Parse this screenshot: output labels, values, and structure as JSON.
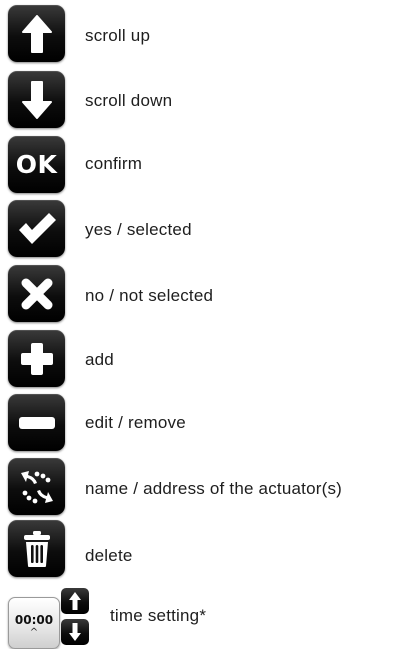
{
  "legend": {
    "scroll_up": "scroll up",
    "scroll_down": "scroll down",
    "confirm_symbol": "OK",
    "confirm": "confirm",
    "yes_selected": "yes / selected",
    "no_not_selected": "no / not selected",
    "add": "add",
    "edit_remove": "edit / remove",
    "actuator_name_address": "name / address of the actuator(s)",
    "delete": "delete",
    "time_value": "00:00",
    "time_caret": "^",
    "time_setting": "time setting*"
  },
  "icons": {
    "scroll_up": "arrow-up-icon",
    "scroll_down": "arrow-down-icon",
    "confirm": "ok-icon",
    "yes_selected": "checkmark-icon",
    "no_not_selected": "x-icon",
    "add": "plus-icon",
    "edit_remove": "minus-icon",
    "actuator": "signal-dots-icon",
    "delete": "trash-icon"
  },
  "colors": {
    "button_background": "#000000",
    "icon_foreground": "#ffffff",
    "label_text": "#1e1e1e",
    "page_background": "#ffffff"
  }
}
